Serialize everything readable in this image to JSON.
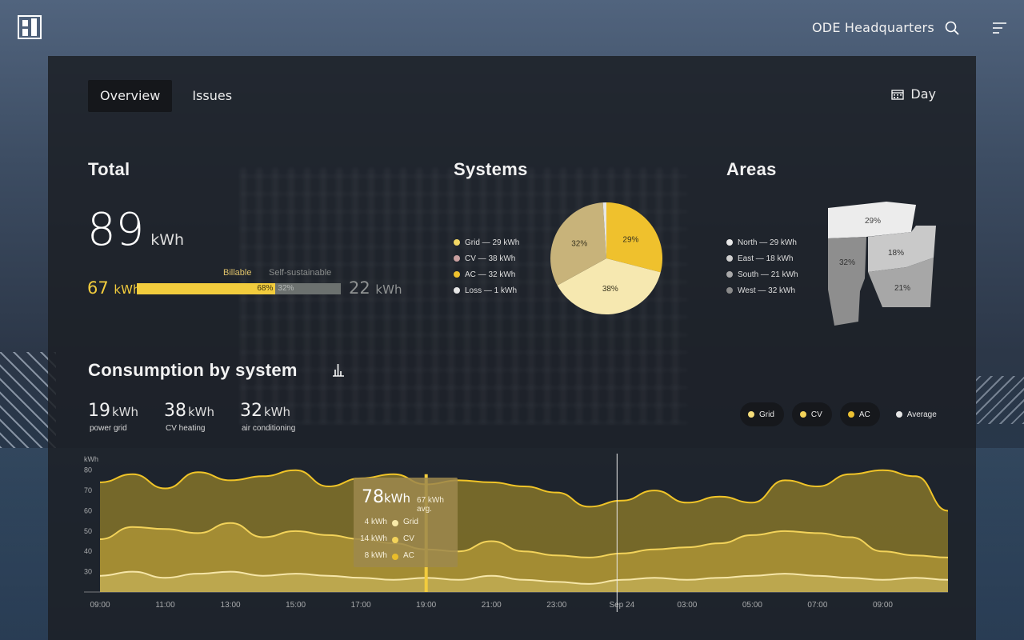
{
  "colors": {
    "grid": "#f5dd7a",
    "cv": "#f3dca0",
    "ac": "#ecc132",
    "loss": "#e6e6e6",
    "accent": "#f2cc3d",
    "self": "#6c716f"
  },
  "header": {
    "site_name": "ODE  Headquarters",
    "logo_icon": "building-logo-icon",
    "search_icon": "search-icon",
    "menu_icon": "menu-icon"
  },
  "tabs": [
    {
      "label": "Overview",
      "active": true
    },
    {
      "label": "Issues",
      "active": false
    }
  ],
  "period": {
    "label": "Day",
    "icon": "calendar-icon"
  },
  "total": {
    "title": "Total",
    "value": "89",
    "unit": "kWh",
    "billable": {
      "label": "Billable",
      "value": "67",
      "unit": "kWh",
      "percent_label": "68%",
      "fraction": 0.68
    },
    "self_sustainable": {
      "label": "Self-sustainable",
      "value": "22",
      "unit": "kWh",
      "percent_label": "32%",
      "fraction": 0.32
    }
  },
  "systems": {
    "title": "Systems",
    "legend": [
      {
        "label": "Grid — 29 kWh",
        "color": "#f3d865"
      },
      {
        "label": "CV — 38 kWh",
        "color": "#c9a0a0"
      },
      {
        "label": "AC — 32 kWh",
        "color": "#efc12d"
      },
      {
        "label": "Loss — 1 kWh",
        "color": "#e6e6e6"
      }
    ]
  },
  "areas": {
    "title": "Areas",
    "legend": [
      {
        "label": "North — 29 kWh",
        "color": "#e9e9e9"
      },
      {
        "label": "East — 18 kWh",
        "color": "#cfcfcf"
      },
      {
        "label": "South — 21 kWh",
        "color": "#a9a9a9"
      },
      {
        "label": "West — 32 kWh",
        "color": "#8a8a8a"
      }
    ],
    "regions": [
      {
        "name": "North",
        "percent_label": "29%"
      },
      {
        "name": "East",
        "percent_label": "18%"
      },
      {
        "name": "South",
        "percent_label": "21%"
      },
      {
        "name": "West",
        "percent_label": "32%"
      }
    ]
  },
  "consumption": {
    "title": "Consumption by system",
    "chart_icon": "bar-chart-icon",
    "kpis": [
      {
        "value": "19",
        "unit": "kWh",
        "label": "power grid"
      },
      {
        "value": "38",
        "unit": "kWh",
        "label": "CV heating"
      },
      {
        "value": "32",
        "unit": "kWh",
        "label": "air conditioning"
      }
    ],
    "legend": [
      {
        "label": "Grid",
        "color": "#f5dd7a",
        "active": true
      },
      {
        "label": "CV",
        "color": "#f3d35a",
        "active": true
      },
      {
        "label": "AC",
        "color": "#ecc132",
        "active": true
      },
      {
        "label": "Average",
        "color": "#e6e6e6",
        "active": false
      }
    ],
    "tooltip": {
      "value": "78",
      "unit": "kWh",
      "avg": "67 kWh avg.",
      "rows": [
        {
          "value": "4 kWh",
          "name": "Grid",
          "color": "#f8eaa8"
        },
        {
          "value": "14 kWh",
          "name": "CV",
          "color": "#f3d35a"
        },
        {
          "value": "8 kWh",
          "name": "AC",
          "color": "#e9bd2a"
        }
      ]
    }
  },
  "chart_data": [
    {
      "type": "pie",
      "title": "Systems",
      "categories": [
        "Grid",
        "CV",
        "AC",
        "Loss"
      ],
      "values": [
        29,
        38,
        32,
        1
      ],
      "labels": [
        "29%",
        "38%",
        "32%",
        ""
      ],
      "colors": [
        "#efc12d",
        "#f6e8b0",
        "#c8b37a",
        "#e6e6e6"
      ]
    },
    {
      "type": "area",
      "title": "Consumption by system",
      "ylabel": "kWh",
      "ylim": [
        20,
        85
      ],
      "yticks": [
        30,
        40,
        50,
        60,
        70,
        80
      ],
      "xticks": [
        "09:00",
        "11:00",
        "13:00",
        "15:00",
        "17:00",
        "19:00",
        "21:00",
        "23:00",
        "Sep 24",
        "03:00",
        "05:00",
        "07:00",
        "09:00"
      ],
      "x_hours": [
        0,
        1,
        2,
        3,
        4,
        5,
        6,
        7,
        8,
        9,
        10,
        11,
        12,
        13,
        14,
        15,
        16,
        17,
        18,
        19,
        20,
        21,
        22,
        23,
        24,
        25,
        26
      ],
      "series": [
        {
          "name": "Grid",
          "values": [
            74,
            78,
            71,
            79,
            75,
            77,
            80,
            72,
            76,
            78,
            73,
            75,
            74,
            72,
            69,
            62,
            65,
            70,
            64,
            67,
            64,
            75,
            72,
            78,
            80,
            77,
            60
          ]
        },
        {
          "name": "CV",
          "values": [
            46,
            52,
            51,
            49,
            54,
            47,
            50,
            48,
            46,
            44,
            41,
            40,
            45,
            40,
            38,
            37,
            39,
            41,
            42,
            44,
            48,
            50,
            49,
            47,
            40,
            38,
            37
          ]
        },
        {
          "name": "AC",
          "values": [
            28,
            30,
            27,
            29,
            30,
            28,
            29,
            28,
            27,
            26,
            27,
            26,
            28,
            26,
            25,
            24,
            26,
            27,
            26,
            27,
            28,
            29,
            28,
            27,
            26,
            27,
            26
          ]
        }
      ],
      "highlight": {
        "x": "19:00",
        "total": 78
      },
      "cursor": "Sep 24"
    }
  ]
}
